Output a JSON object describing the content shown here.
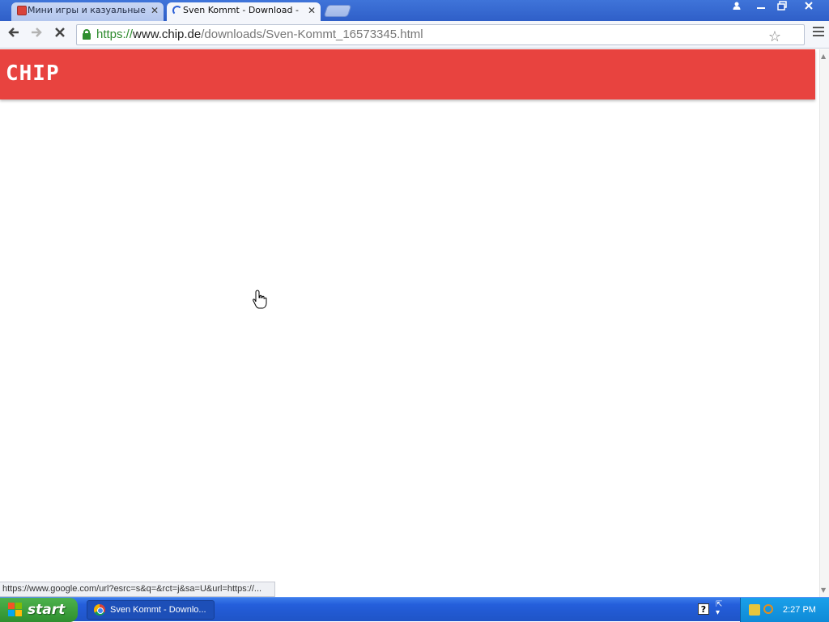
{
  "browser": {
    "tabs": [
      {
        "title": "Мини игры и казуальные и",
        "active": false
      },
      {
        "title": "Sven Kommt - Download - Ch",
        "active": true
      }
    ],
    "url": {
      "scheme": "https://",
      "host": "www.chip.de",
      "path": "/downloads/Sven-Kommt_16573345.html"
    },
    "status_text": "https://www.google.com/url?esrc=s&q=&rct=j&sa=U&url=https://..."
  },
  "site": {
    "logo_text": "CHIP",
    "brand_color": "#e8433f"
  },
  "taskbar": {
    "start_label": "start",
    "task_label": "Sven Kommt - Downlo...",
    "clock": "2:27 PM"
  },
  "icons": {
    "back": "back-arrow-icon",
    "forward": "forward-arrow-icon",
    "stop": "stop-x-icon",
    "lock": "lock-icon",
    "star": "bookmark-star-icon",
    "menu": "hamburger-menu-icon"
  }
}
